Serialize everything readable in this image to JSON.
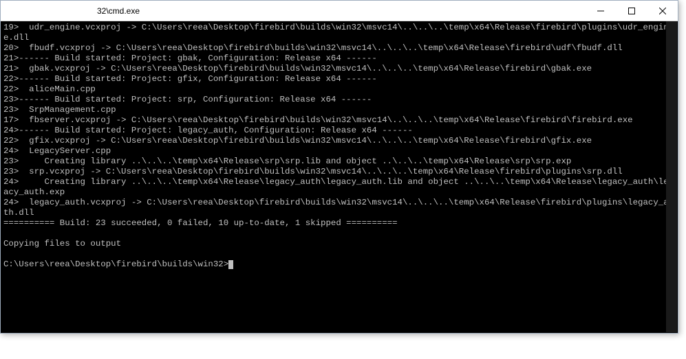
{
  "window": {
    "title": "32\\cmd.exe"
  },
  "partial_title": "",
  "console_lines": [
    "19>  udr_engine.vcxproj -> C:\\Users\\reea\\Desktop\\firebird\\builds\\win32\\msvc14\\..\\..\\..\\temp\\x64\\Release\\firebird\\plugins\\udr_engine.dll",
    "20>  fbudf.vcxproj -> C:\\Users\\reea\\Desktop\\firebird\\builds\\win32\\msvc14\\..\\..\\..\\temp\\x64\\Release\\firebird\\udf\\fbudf.dll",
    "21>------ Build started: Project: gbak, Configuration: Release x64 ------",
    "21>  gbak.vcxproj -> C:\\Users\\reea\\Desktop\\firebird\\builds\\win32\\msvc14\\..\\..\\..\\temp\\x64\\Release\\firebird\\gbak.exe",
    "22>------ Build started: Project: gfix, Configuration: Release x64 ------",
    "22>  aliceMain.cpp",
    "23>------ Build started: Project: srp, Configuration: Release x64 ------",
    "23>  SrpManagement.cpp",
    "17>  fbserver.vcxproj -> C:\\Users\\reea\\Desktop\\firebird\\builds\\win32\\msvc14\\..\\..\\..\\temp\\x64\\Release\\firebird\\firebird.exe",
    "24>------ Build started: Project: legacy_auth, Configuration: Release x64 ------",
    "22>  gfix.vcxproj -> C:\\Users\\reea\\Desktop\\firebird\\builds\\win32\\msvc14\\..\\..\\..\\temp\\x64\\Release\\firebird\\gfix.exe",
    "24>  LegacyServer.cpp",
    "23>     Creating library ..\\..\\..\\temp\\x64\\Release\\srp\\srp.lib and object ..\\..\\..\\temp\\x64\\Release\\srp\\srp.exp",
    "23>  srp.vcxproj -> C:\\Users\\reea\\Desktop\\firebird\\builds\\win32\\msvc14\\..\\..\\..\\temp\\x64\\Release\\firebird\\plugins\\srp.dll",
    "24>     Creating library ..\\..\\..\\temp\\x64\\Release\\legacy_auth\\legacy_auth.lib and object ..\\..\\..\\temp\\x64\\Release\\legacy_auth\\legacy_auth.exp",
    "24>  legacy_auth.vcxproj -> C:\\Users\\reea\\Desktop\\firebird\\builds\\win32\\msvc14\\..\\..\\..\\temp\\x64\\Release\\firebird\\plugins\\legacy_auth.dll",
    "========== Build: 23 succeeded, 0 failed, 10 up-to-date, 1 skipped ==========",
    "",
    "Copying files to output",
    "",
    "C:\\Users\\reea\\Desktop\\firebird\\builds\\win32>"
  ]
}
